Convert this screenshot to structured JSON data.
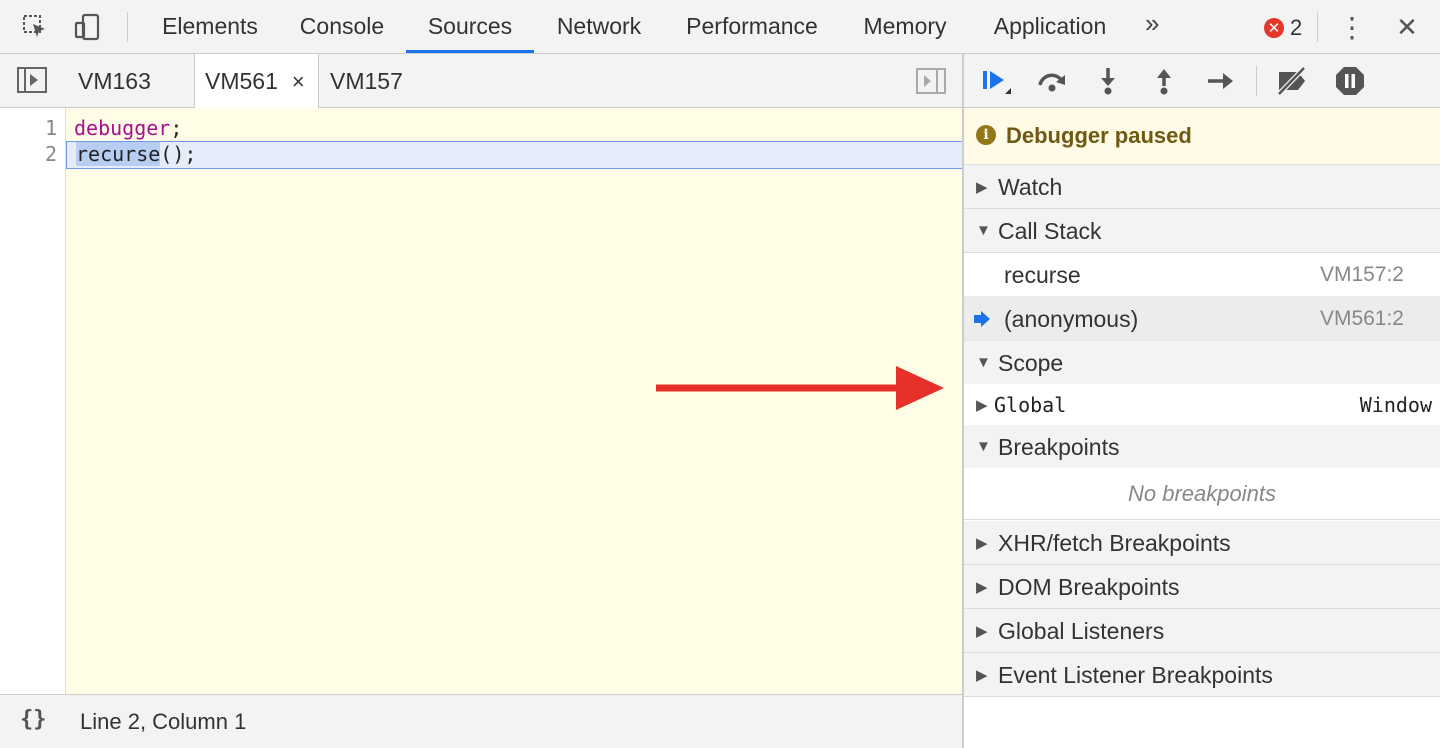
{
  "toolbar": {
    "tabs": [
      "Elements",
      "Console",
      "Sources",
      "Network",
      "Performance",
      "Memory",
      "Application"
    ],
    "active_tab": "Sources",
    "more": "»",
    "error_count": "2",
    "error_icon": "✕",
    "menu": "⋮",
    "close": "✕"
  },
  "editor": {
    "file_tabs": [
      "VM163",
      "VM561",
      "VM157"
    ],
    "active_file": "VM561",
    "close_glyph": "×",
    "lines": [
      {
        "num": "1",
        "keyword": "debugger",
        "rest": ";"
      },
      {
        "num": "2",
        "selected": "recurse",
        "rest": "();"
      }
    ],
    "status_braces": "{}",
    "status_position": "Line 2, Column 1"
  },
  "debugger": {
    "paused_text": "Debugger paused",
    "info_glyph": "i",
    "sections": {
      "watch": "Watch",
      "call_stack": "Call Stack",
      "scope": "Scope",
      "breakpoints": "Breakpoints",
      "xhr": "XHR/fetch Breakpoints",
      "dom": "DOM Breakpoints",
      "global_listeners": "Global Listeners",
      "event_listeners": "Event Listener Breakpoints"
    },
    "call_stack": [
      {
        "name": "recurse",
        "location": "VM157:2",
        "current": false
      },
      {
        "name": "(anonymous)",
        "location": "VM561:2",
        "current": true
      }
    ],
    "scope": {
      "key": "Global",
      "value": "Window"
    },
    "no_breakpoints": "No breakpoints"
  },
  "colors": {
    "accent": "#1a73e8",
    "annotation_arrow": "#e8302a",
    "paused_bg": "#fffbe6",
    "editor_bg": "#fffde6"
  }
}
